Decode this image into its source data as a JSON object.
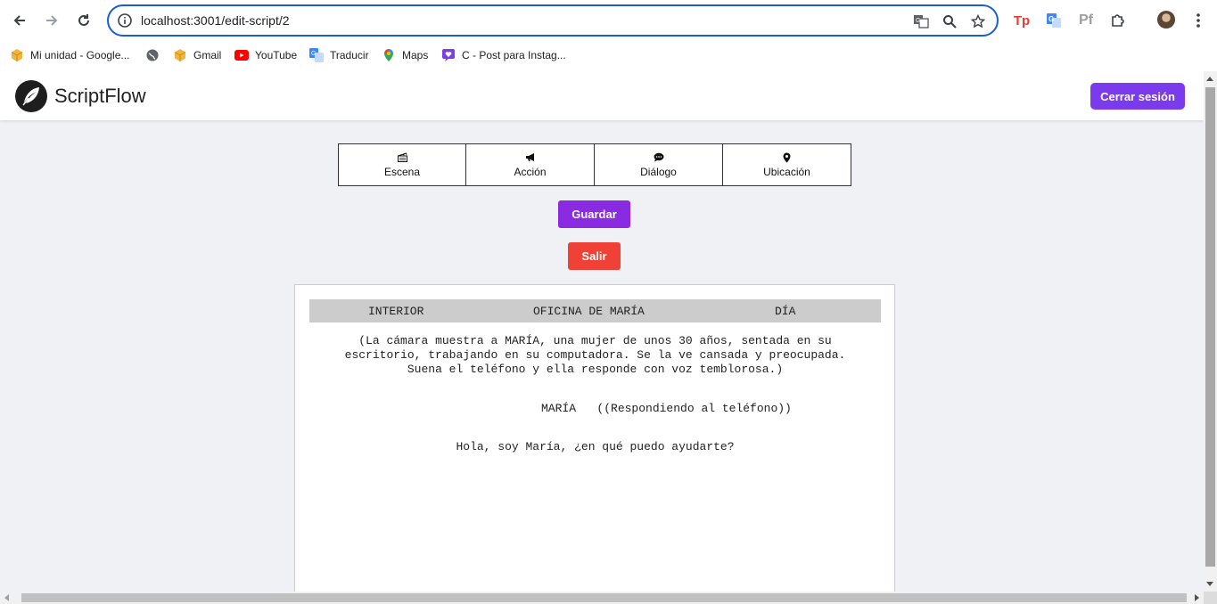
{
  "browser": {
    "url": "localhost:3001/edit-script/2",
    "bookmarks": [
      {
        "label": "Mi unidad - Google...",
        "icon": "drive-icon"
      },
      {
        "label": "",
        "icon": "globe-icon"
      },
      {
        "label": "Gmail",
        "icon": "drive-icon"
      },
      {
        "label": "YouTube",
        "icon": "youtube-icon"
      },
      {
        "label": "Traducir",
        "icon": "translate-icon"
      },
      {
        "label": "Maps",
        "icon": "maps-icon"
      },
      {
        "label": "C - Post para Instag...",
        "icon": "bookmark-heart-icon"
      }
    ],
    "extensions": {
      "tp": "Tp",
      "pf": "Pf"
    }
  },
  "app": {
    "brand": "ScriptFlow",
    "logout_label": "Cerrar sesión",
    "tools": [
      {
        "label": "Escena",
        "icon": "clapperboard-icon"
      },
      {
        "label": "Acción",
        "icon": "megaphone-icon"
      },
      {
        "label": "Diálogo",
        "icon": "speech-bubble-icon"
      },
      {
        "label": "Ubicación",
        "icon": "map-pin-icon"
      }
    ],
    "save_label": "Guardar",
    "exit_label": "Salir",
    "colors": {
      "primary": "#7c3aed",
      "save": "#8a2be2",
      "exit": "#ef4136",
      "background": "#f0f1f5"
    }
  },
  "script": {
    "scene": {
      "interior": "INTERIOR",
      "location": "OFICINA DE MARÍA",
      "time": "DÍA"
    },
    "action_lines": [
      "(La cámara muestra a MARÍA, una mujer de unos 30 años, sentada en su",
      "escritorio, trabajando en su computadora. Se la ve cansada y preocupada.",
      "Suena el teléfono y ella responde con voz temblorosa.)"
    ],
    "character": "MARÍA",
    "parenthetical": "((Respondiendo al teléfono))",
    "dialogue": "Hola, soy María, ¿en qué puedo ayudarte?"
  }
}
